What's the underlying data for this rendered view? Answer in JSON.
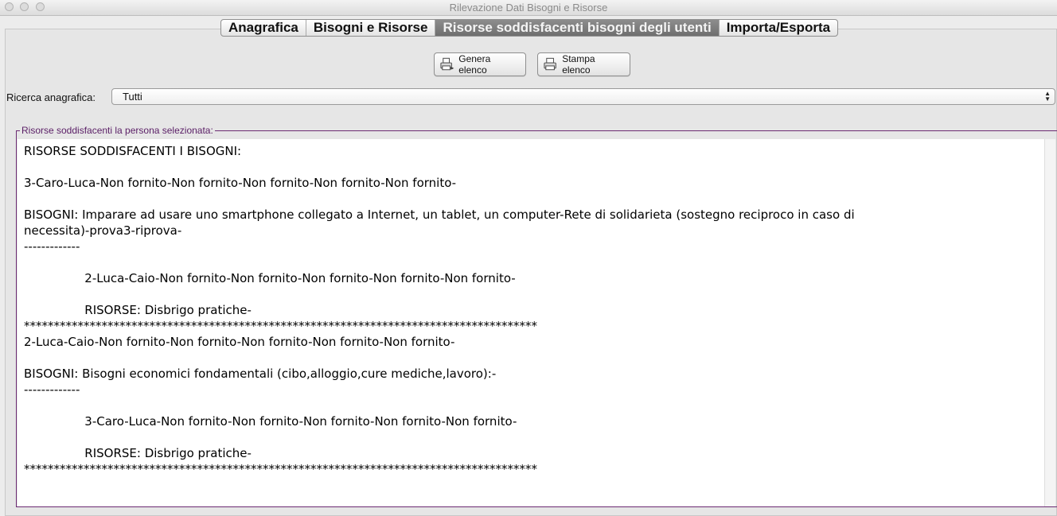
{
  "window": {
    "title": "Rilevazione Dati Bisogni e Risorse"
  },
  "tabs": [
    {
      "label": "Anagrafica",
      "active": false
    },
    {
      "label": "Bisogni e Risorse",
      "active": false
    },
    {
      "label": "Risorse soddisfacenti bisogni degli utenti",
      "active": true
    },
    {
      "label": "Importa/Esporta",
      "active": false
    }
  ],
  "toolbar": {
    "genera_label": "Genera elenco",
    "stampa_label": "Stampa elenco",
    "genera_icon": "printer-generate-icon",
    "stampa_icon": "printer-icon"
  },
  "search": {
    "label": "Ricerca anagrafica:",
    "selected": "Tutti"
  },
  "results": {
    "legend": "Risorse soddisfacenti la persona selezionata:",
    "lines": [
      "RISORSE SODDISFACENTI I BISOGNI:",
      "",
      "3-Caro-Luca-Non fornito-Non fornito-Non fornito-Non fornito-Non fornito-",
      "",
      "BISOGNI: Imparare ad usare uno smartphone collegato a Internet, un tablet, un computer-Rete di solidarieta (sostegno reciproco in caso di",
      "necessita)-prova3-riprova-",
      "-------------",
      "",
      "                2-Luca-Caio-Non fornito-Non fornito-Non fornito-Non fornito-Non fornito-",
      "",
      "                RISORSE: Disbrigo pratiche-",
      "**************************************************************************************",
      "2-Luca-Caio-Non fornito-Non fornito-Non fornito-Non fornito-Non fornito-",
      "",
      "BISOGNI: Bisogni economici fondamentali (cibo,alloggio,cure mediche,lavoro):-",
      "-------------",
      "",
      "                3-Caro-Luca-Non fornito-Non fornito-Non fornito-Non fornito-Non fornito-",
      "",
      "                RISORSE: Disbrigo pratiche-",
      "**************************************************************************************"
    ]
  },
  "colors": {
    "fieldset_border": "#6b2a72",
    "active_tab": "#7d7d7d"
  }
}
